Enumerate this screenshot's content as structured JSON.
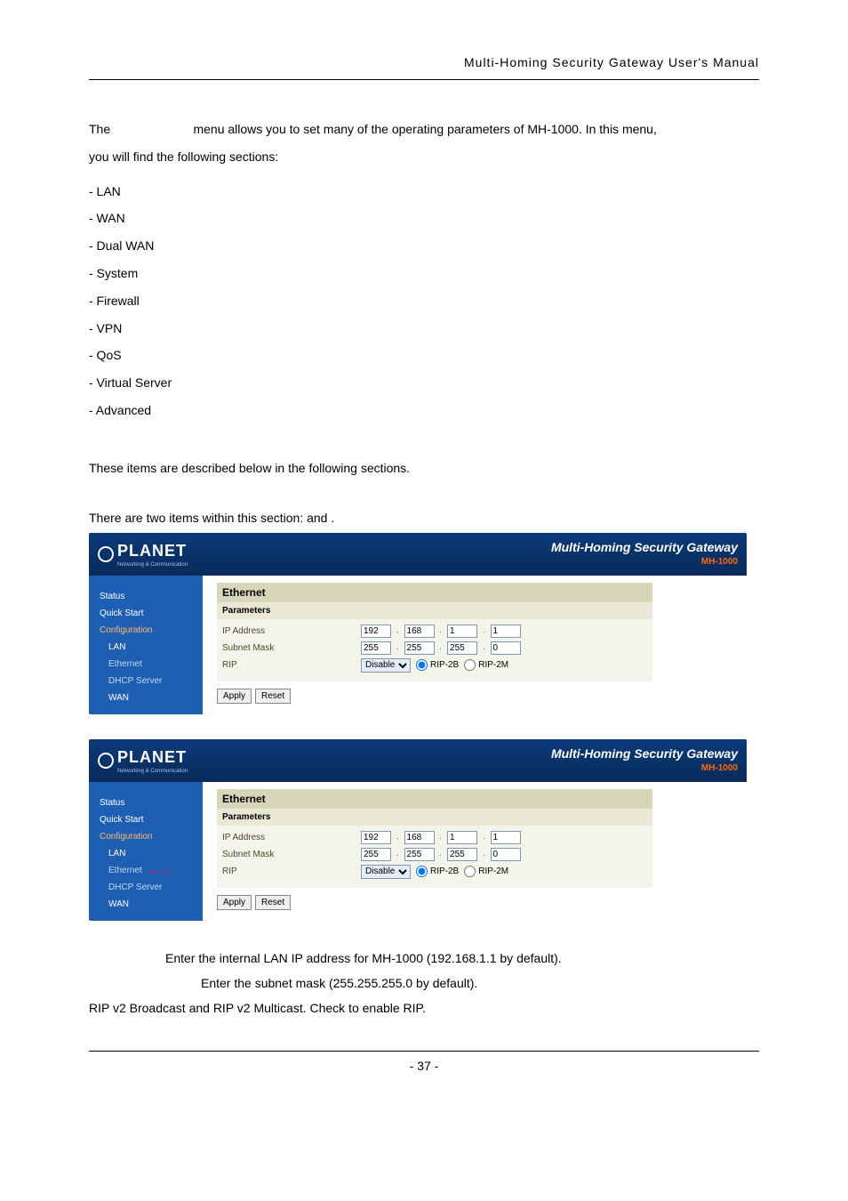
{
  "header": {
    "title": "Multi-Homing  Security  Gateway  User's  Manual"
  },
  "intro": {
    "line1a": "The ",
    "line1b": " menu allows you to set many of the operating parameters of MH-1000. In this menu,",
    "line2": "you will find the following sections:"
  },
  "sections": [
    "- LAN",
    "- WAN",
    "- Dual WAN",
    "- System",
    "- Firewall",
    "- VPN",
    "- QoS",
    "- Virtual Server",
    "- Advanced"
  ],
  "para2": "These items are described below in the following sections.",
  "lan_intro_a": "There are two items within this section: ",
  "lan_intro_b": " and ",
  "lan_intro_c": ".",
  "router": {
    "brand": "PLANET",
    "brand_sub": "Networking & Communication",
    "product": "Multi-Homing Security Gateway",
    "model": "MH-1000",
    "sidebar": {
      "status": "Status",
      "quickstart": "Quick Start",
      "configuration": "Configuration",
      "lan": "LAN",
      "ethernet": "Ethernet",
      "dhcp": "DHCP Server",
      "wan": "WAN"
    },
    "panel": {
      "title": "Ethernet",
      "subtitle": "Parameters",
      "ip_label": "IP Address",
      "subnet_label": "Subnet Mask",
      "rip_label": "RIP",
      "ip": [
        "192",
        "168",
        "1",
        "1"
      ],
      "mask": [
        "255",
        "255",
        "255",
        "0"
      ],
      "rip_select": "Disable",
      "rip_opt1": "RIP-2B",
      "rip_opt2": "RIP-2M",
      "apply": "Apply",
      "reset": "Reset"
    }
  },
  "desc": {
    "l1": "Enter the internal LAN IP address for MH-1000 (192.168.1.1 by default).",
    "l2": "Enter the subnet mask (255.255.255.0 by default).",
    "l3": "RIP v2 Broadcast and RIP v2 Multicast. Check to enable RIP."
  },
  "footer": {
    "page": "- 37 -"
  }
}
